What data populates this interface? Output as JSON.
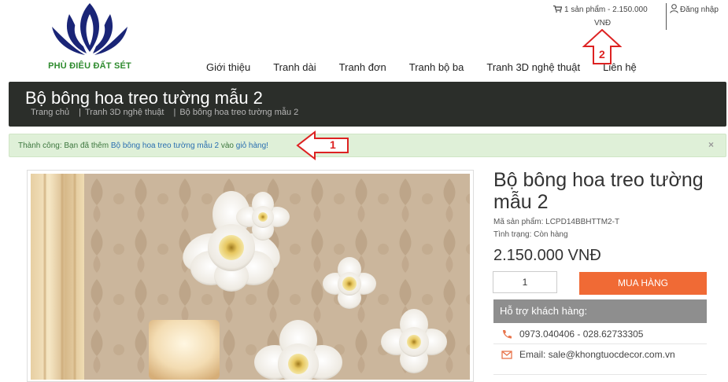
{
  "brand": {
    "name": "PHÙ ĐIÊU ĐẤT SÉT"
  },
  "topbar": {
    "cart_text": "1 sản phẩm - 2.150.000",
    "cart_currency": "VNĐ",
    "login_label": "Đăng nhập"
  },
  "nav": {
    "items": [
      {
        "label": "Giới thiệu"
      },
      {
        "label": "Tranh dài"
      },
      {
        "label": "Tranh đơn"
      },
      {
        "label": "Tranh bộ ba"
      },
      {
        "label": "Tranh 3D nghệ thuật"
      },
      {
        "label": "Liên hệ"
      }
    ]
  },
  "page": {
    "title": "Bộ bông hoa treo tường mẫu 2",
    "breadcrumb": [
      "Trang chủ",
      "Tranh 3D nghệ thuật",
      "Bộ bông hoa treo tường mẫu 2"
    ]
  },
  "alert": {
    "prefix": "Thành công: Bạn đã thêm",
    "product_link": "Bộ bông hoa treo tường mẫu 2",
    "middle": "vào",
    "cart_link": "giỏ hàng!",
    "close": "×"
  },
  "annotations": [
    {
      "label": "1"
    },
    {
      "label": "2"
    }
  ],
  "product": {
    "name": "Bộ bông hoa treo tường mẫu 2",
    "code": "Mã sản phẩm: LCPD14BBHTTM2-T",
    "status": "Tình trạng: Còn hàng",
    "price": "2.150.000 VNĐ",
    "quantity": "1",
    "buy_label": "MUA HÀNG",
    "support_title": "Hỗ trợ khách hàng:",
    "phone": "0973.040406 - 028.62733305",
    "email": "Email: sale@khongtuocdecor.com.vn"
  },
  "colors": {
    "accent": "#f06a35",
    "titlebar": "#2b2e2a",
    "alert_bg": "#dff0d8",
    "annotation": "#dd2222"
  }
}
